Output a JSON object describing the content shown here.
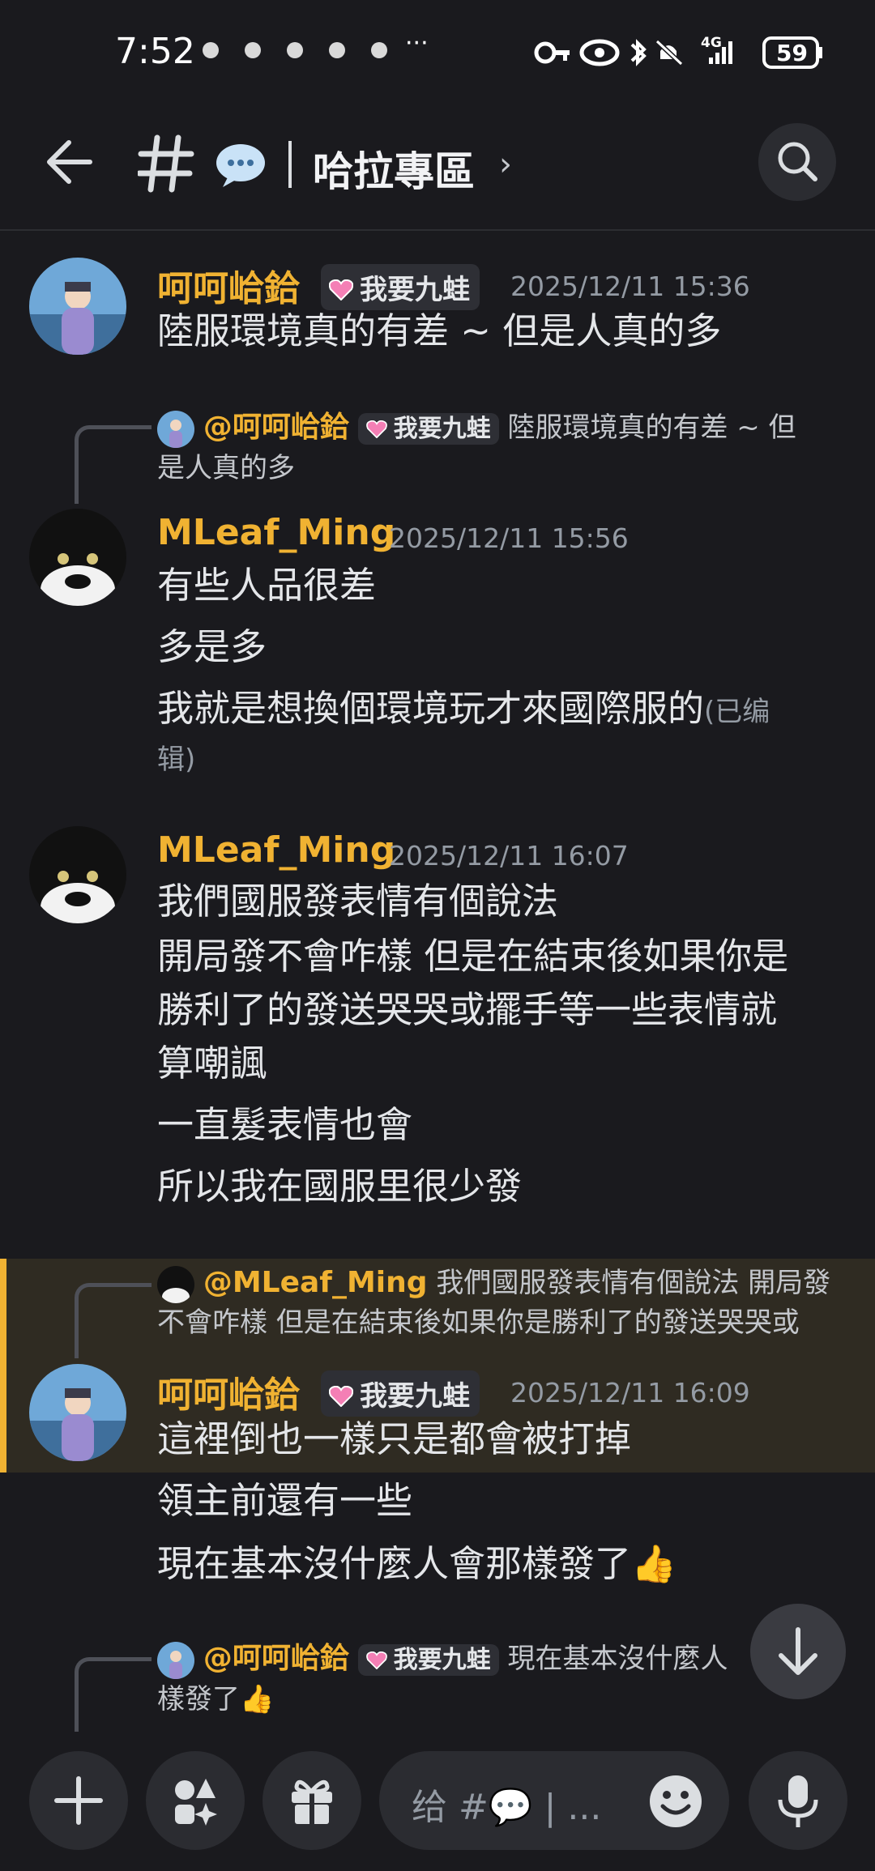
{
  "status_bar": {
    "time": "7:52",
    "more": "···",
    "network": "4G",
    "battery": "59"
  },
  "header": {
    "channel_name": "哈拉專區",
    "chevron": "›"
  },
  "messages": [
    {
      "author": "呵呵峆鉿",
      "badge": "我要九蛙",
      "timestamp": "2025/12/11 15:36",
      "lines": [
        "陸服環境真的有差 ~ 但是人真的多"
      ]
    },
    {
      "reply": {
        "author": "@呵呵峆鉿",
        "badge": "我要九蛙",
        "line1": "陸服環境真的有差 ~ 但",
        "line2": "是人真的多"
      },
      "author": "MLeaf_Ming",
      "timestamp": "2025/12/11 15:56",
      "lines": [
        "有些人品很差",
        "多是多",
        "我就是想換個環境玩才來國際服的"
      ],
      "edited_1": "(已编",
      "edited_2": "辑)"
    },
    {
      "author": "MLeaf_Ming",
      "timestamp": "2025/12/11 16:07",
      "lines": [
        "我們國服發表情有個說法",
        "開局發不會咋樣 但是在結束後如果你是",
        "勝利了的發送哭哭或擺手等一些表情就",
        "算嘲諷",
        "一直髮表情也會",
        "所以我在國服里很少發"
      ]
    },
    {
      "reply": {
        "author": "@MLeaf_Ming",
        "line1": "我們國服發表情有個說法  開局發",
        "line2": "不會咋樣 但是在結束後如果你是勝利了的發送哭哭或"
      },
      "author": "呵呵峆鉿",
      "badge": "我要九蛙",
      "timestamp": "2025/12/11 16:09",
      "lines": [
        "這裡倒也一樣只是都會被打掉",
        "領主前還有一些",
        "現在基本沒什麼人會那樣發了👍"
      ]
    },
    {
      "reply": {
        "author": "@呵呵峆鉿",
        "badge": "我要九蛙",
        "line1": "現在基本沒什麼人",
        "line2": "樣發了👍"
      }
    }
  ],
  "composer": {
    "placeholder": "给 #💬 | ..."
  },
  "colors": {
    "background": "#1a1a1e",
    "username": "#f0b232",
    "timestamp": "#949ba4",
    "highlight": "#2f2b22"
  },
  "icons": [
    "back-arrow-icon",
    "hash-icon",
    "speech-bubble-icon",
    "search-icon",
    "plus-icon",
    "apps-icon",
    "gift-icon",
    "emoji-icon",
    "mic-icon",
    "scroll-down-icon"
  ]
}
